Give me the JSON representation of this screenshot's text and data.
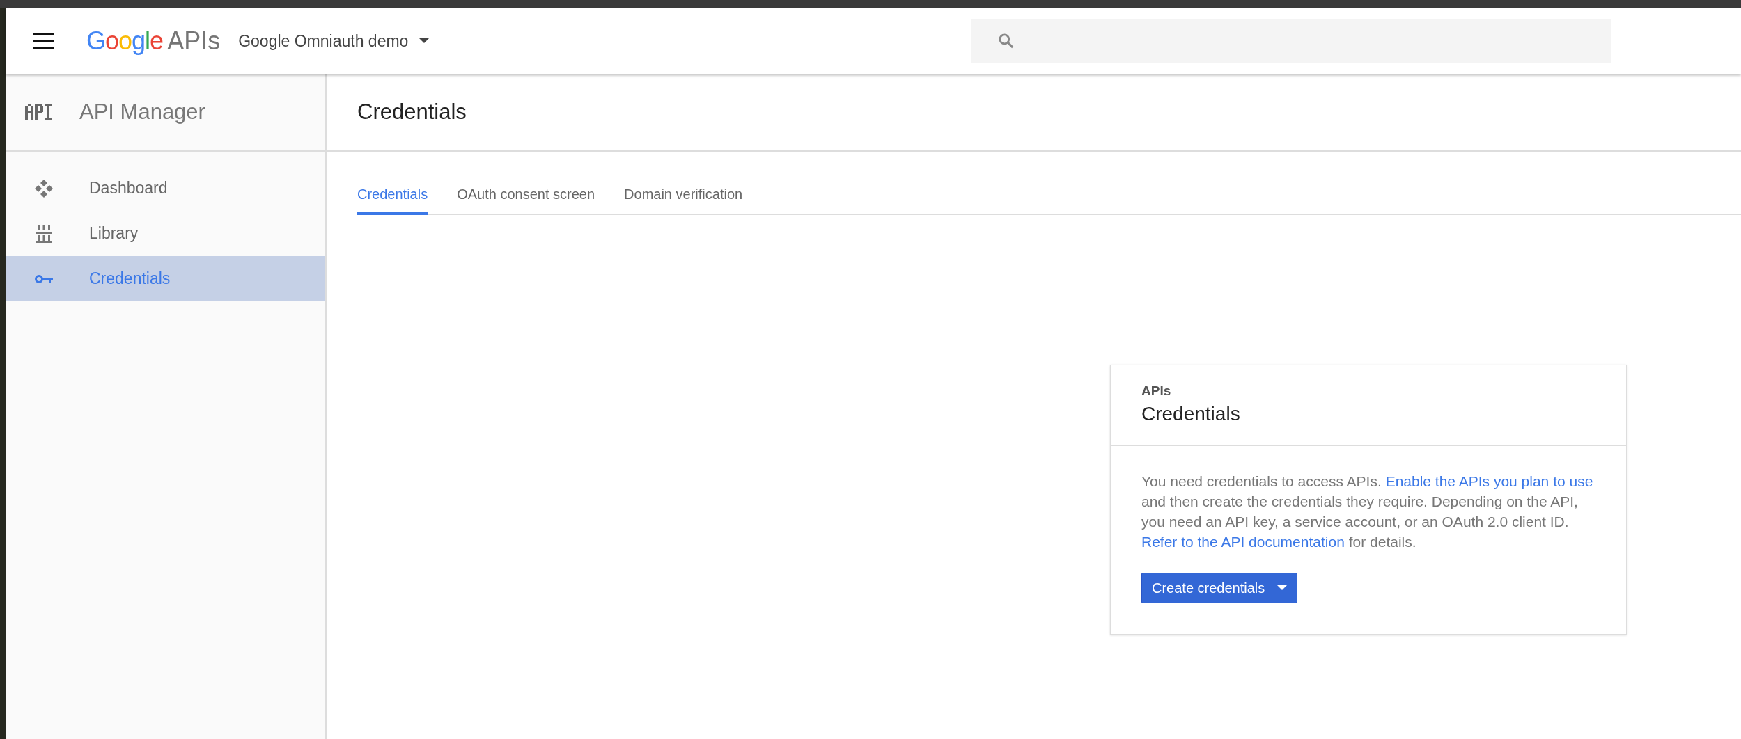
{
  "topbar": {
    "logo": "Google",
    "product": "APIs",
    "project": "Google Omniauth demo"
  },
  "sidebar": {
    "title": "API Manager",
    "items": [
      {
        "label": "Dashboard",
        "kind": "dashboard",
        "selected": false
      },
      {
        "label": "Library",
        "kind": "library",
        "selected": false
      },
      {
        "label": "Credentials",
        "kind": "key",
        "selected": true
      }
    ]
  },
  "page": {
    "title": "Credentials"
  },
  "tabs": [
    {
      "label": "Credentials",
      "selected": true
    },
    {
      "label": "OAuth consent screen",
      "selected": false
    },
    {
      "label": "Domain verification",
      "selected": false
    }
  ],
  "card": {
    "eyebrow": "APIs",
    "title": "Credentials",
    "text": [
      {
        "kind": "text",
        "text": "You need credentials to access APIs. "
      },
      {
        "kind": "link",
        "text": "Enable the APIs you plan to use"
      },
      {
        "kind": "text",
        "text": " and then create the credentials they require. Depending on the API, you need an API key, a service account, or an OAuth 2.0 client ID. "
      },
      {
        "kind": "link",
        "text": "Refer to the API documentation"
      },
      {
        "kind": "text",
        "text": " for details."
      }
    ],
    "button": "Create credentials"
  }
}
